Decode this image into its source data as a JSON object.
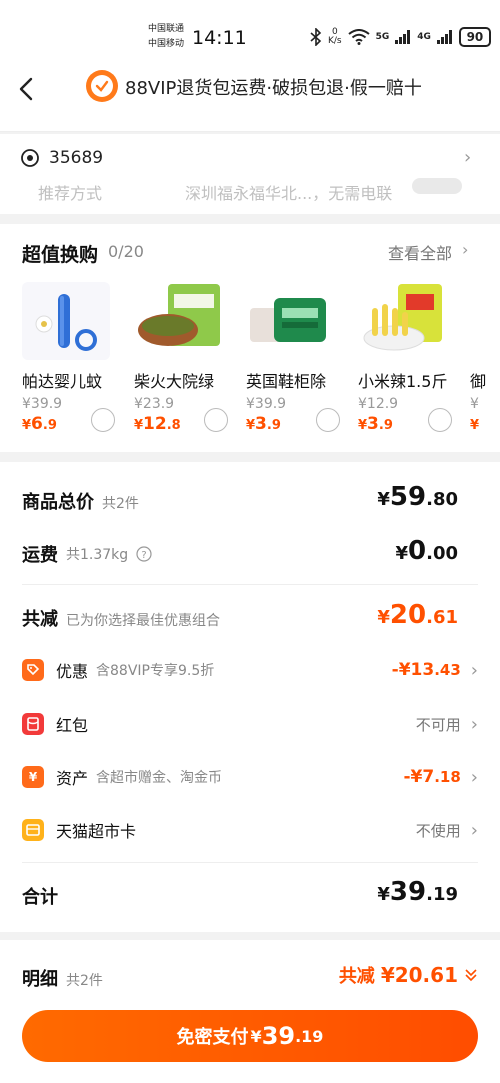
{
  "status_bar": {
    "carrier1": "中国联通",
    "carrier2": "中国移动",
    "time": "14:11",
    "speed_top": "0",
    "speed_bottom": "K/s",
    "net1": "5G",
    "net2": "4G",
    "battery": "90"
  },
  "header": {
    "title": "88VIP退货包运费·破损包退·假一赔十",
    "badge_icon": "shield-check-icon"
  },
  "address": {
    "code": "35689",
    "faded_left": "推荐方式",
    "faded_right": "深圳福永福华北...，无需电联"
  },
  "exchange": {
    "title": "超值换购",
    "count": "0/20",
    "view_all": "查看全部",
    "products": [
      {
        "name": "帕达婴儿蚊",
        "orig": "¥39.9",
        "price_int": "6",
        "price_dec": ".9"
      },
      {
        "name": "柴火大院绿",
        "orig": "¥23.9",
        "price_int": "12",
        "price_dec": ".8"
      },
      {
        "name": "英国鞋柜除",
        "orig": "¥39.9",
        "price_int": "3",
        "price_dec": ".9"
      },
      {
        "name": "小米辣1.5斤",
        "orig": "¥12.9",
        "price_int": "3",
        "price_dec": ".9"
      },
      {
        "name": "御",
        "orig": "¥",
        "price_int": "",
        "price_dec": ""
      }
    ]
  },
  "summary": {
    "goods_label": "商品总价",
    "goods_count": "共2件",
    "goods_int": "59",
    "goods_dec": ".80",
    "ship_label": "运费",
    "ship_weight": "共1.37kg",
    "ship_int": "0",
    "ship_dec": ".00",
    "reduce_label": "共减",
    "reduce_note": "已为你选择最佳优惠组合",
    "reduce_int": "20",
    "reduce_dec": ".61",
    "yen": "¥",
    "rows": [
      {
        "label": "优惠",
        "note": "含88VIP专享9.5折",
        "value_prefix": "-¥",
        "value_int": "13",
        "value_dec": ".43",
        "text": ""
      },
      {
        "label": "红包",
        "note": "",
        "value_prefix": "",
        "value_int": "",
        "value_dec": "",
        "text": "不可用"
      },
      {
        "label": "资产",
        "note": "含超市赠金、淘金币",
        "value_prefix": "-¥",
        "value_int": "7",
        "value_dec": ".18",
        "text": ""
      },
      {
        "label": "天猫超市卡",
        "note": "",
        "value_prefix": "",
        "value_int": "",
        "value_dec": "",
        "text": "不使用"
      }
    ],
    "total_label": "合计",
    "total_int": "39",
    "total_dec": ".19"
  },
  "bottom": {
    "detail_label": "明细",
    "detail_count": "共2件",
    "reduce_text": "共减",
    "reduce_amount": "¥20.61",
    "pay_label": "免密支付",
    "pay_yen": "¥",
    "pay_int": "39",
    "pay_dec": ".19"
  },
  "colors": {
    "accent": "#ff5000",
    "badge": "#ff7a1a",
    "coupon_icon": "#ff6a1a",
    "redpacket_icon": "#f23a3a",
    "asset_icon": "#ff6a1a",
    "card_icon": "#ffb21a"
  },
  "icons": {
    "back": "back-arrow-icon",
    "location": "location-pin-icon",
    "chevron": "chevron-right-icon",
    "help": "question-circle-icon",
    "coupon": "coupon-tag-icon",
    "redpacket": "red-packet-icon",
    "asset": "yen-coin-icon",
    "card": "gift-card-icon",
    "expand": "double-chevron-down-icon"
  }
}
